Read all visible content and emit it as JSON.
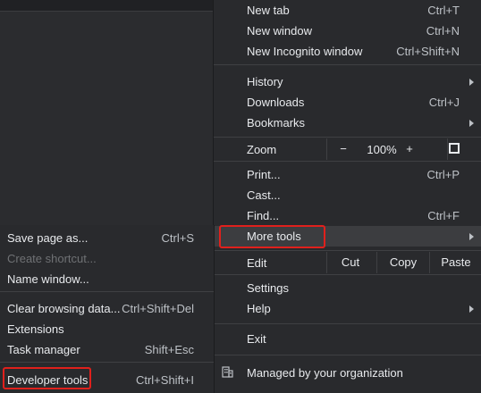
{
  "main_menu": {
    "new_tab": {
      "label": "New tab",
      "shortcut": "Ctrl+T"
    },
    "new_window": {
      "label": "New window",
      "shortcut": "Ctrl+N"
    },
    "new_incognito": {
      "label": "New Incognito window",
      "shortcut": "Ctrl+Shift+N"
    },
    "history": {
      "label": "History"
    },
    "downloads": {
      "label": "Downloads",
      "shortcut": "Ctrl+J"
    },
    "bookmarks": {
      "label": "Bookmarks"
    },
    "zoom": {
      "label": "Zoom",
      "minus": "−",
      "value": "100%",
      "plus": "+"
    },
    "print": {
      "label": "Print...",
      "shortcut": "Ctrl+P"
    },
    "cast": {
      "label": "Cast..."
    },
    "find": {
      "label": "Find...",
      "shortcut": "Ctrl+F"
    },
    "more_tools": {
      "label": "More tools"
    },
    "edit": {
      "label": "Edit",
      "cut": "Cut",
      "copy": "Copy",
      "paste": "Paste"
    },
    "settings": {
      "label": "Settings"
    },
    "help": {
      "label": "Help"
    },
    "exit": {
      "label": "Exit"
    },
    "managed": {
      "label": "Managed by your organization"
    }
  },
  "more_tools_menu": {
    "save_page": {
      "label": "Save page as...",
      "shortcut": "Ctrl+S"
    },
    "create_shortcut": {
      "label": "Create shortcut..."
    },
    "name_window": {
      "label": "Name window..."
    },
    "clear_browsing": {
      "label": "Clear browsing data...",
      "shortcut": "Ctrl+Shift+Del"
    },
    "extensions": {
      "label": "Extensions"
    },
    "task_manager": {
      "label": "Task manager",
      "shortcut": "Shift+Esc"
    },
    "developer_tools": {
      "label": "Developer tools",
      "shortcut": "Ctrl+Shift+I"
    }
  },
  "colors": {
    "highlight": "#e0201c",
    "menu_bg": "#292a2d",
    "hover_bg": "#3c3d40"
  }
}
